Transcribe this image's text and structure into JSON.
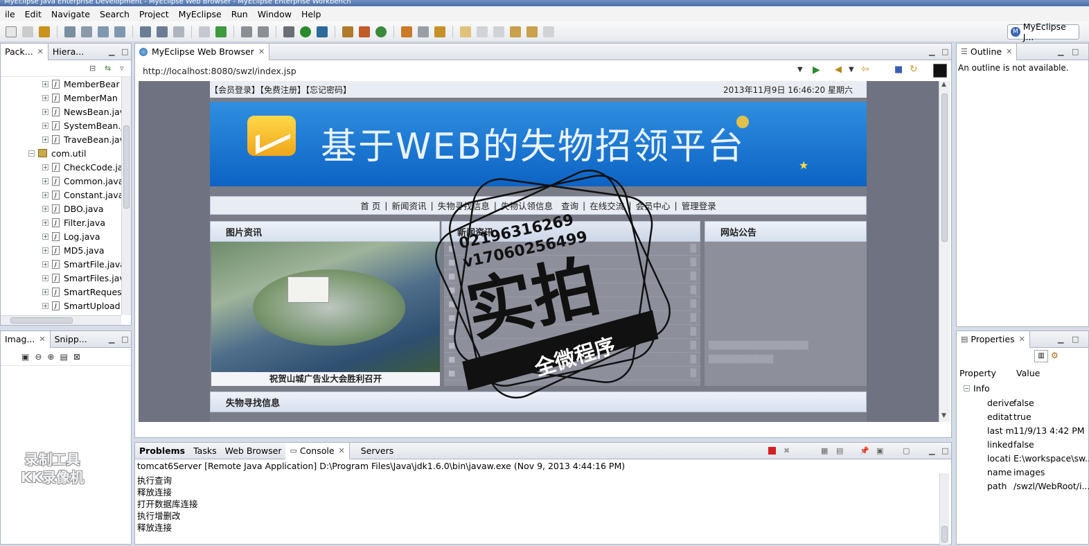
{
  "window": {
    "title": "MyEclipse Java Enterprise Development - MyEclipse Web Browser - MyEclipse Enterprise Workbench"
  },
  "menu": [
    "ile",
    "Edit",
    "Navigate",
    "Search",
    "Project",
    "MyEclipse",
    "Run",
    "Window",
    "Help"
  ],
  "perspective": {
    "label": "MyEclipse J..."
  },
  "package_explorer": {
    "tabs": [
      "Pack...",
      "Hiera..."
    ],
    "items": [
      {
        "label": "MemberBear",
        "type": "java"
      },
      {
        "label": "MemberMan",
        "type": "java"
      },
      {
        "label": "NewsBean.jav",
        "type": "java"
      },
      {
        "label": "SystemBean.j",
        "type": "java"
      },
      {
        "label": "TraveBean.jav",
        "type": "java"
      },
      {
        "label": "com.util",
        "type": "package"
      },
      {
        "label": "CheckCode.ja",
        "type": "java"
      },
      {
        "label": "Common.java",
        "type": "java"
      },
      {
        "label": "Constant.java",
        "type": "java"
      },
      {
        "label": "DBO.java",
        "type": "java"
      },
      {
        "label": "Filter.java",
        "type": "java"
      },
      {
        "label": "Log.java",
        "type": "java"
      },
      {
        "label": "MD5.java",
        "type": "java"
      },
      {
        "label": "SmartFile.java",
        "type": "java"
      },
      {
        "label": "SmartFiles.jav",
        "type": "java"
      },
      {
        "label": "SmartReques",
        "type": "java"
      },
      {
        "label": "SmartUpload",
        "type": "java"
      }
    ]
  },
  "image_panel": {
    "tabs": [
      "Imag...",
      "Snipp..."
    ]
  },
  "browser": {
    "tab": "MyEclipse Web Browser",
    "url": "http://localhost:8080/swzl/index.jsp",
    "site": {
      "top_links": "【会员登录】【免费注册】【忘记密码】",
      "datetime": "2013年11月9日  16:46:20   星期六",
      "banner_title": "基于WEB的失物招领平台",
      "nav": [
        "首 页",
        "新闻资讯",
        "失物寻找信息",
        "失物认领信息",
        "查询",
        "在线交流",
        "会员中心",
        "管理登录"
      ],
      "boxes": {
        "photo_title": "图片资讯",
        "news_title": "新闻资讯",
        "notice_title": "网站公告",
        "lost_title": "失物寻找信息"
      },
      "photo_caption": "祝贺山城广告业大会胜利召开"
    }
  },
  "outline": {
    "tab": "Outline",
    "message": "An outline is not available."
  },
  "properties": {
    "tab": "Properties",
    "headers": [
      "Property",
      "Value"
    ],
    "group": "Info",
    "rows": [
      {
        "k": "derive",
        "v": "false"
      },
      {
        "k": "editat",
        "v": "true"
      },
      {
        "k": "last m",
        "v": "11/9/13 4:42 PM"
      },
      {
        "k": "linked",
        "v": "false"
      },
      {
        "k": "locati",
        "v": "E:\\workspace\\sw..."
      },
      {
        "k": "name",
        "v": "images"
      },
      {
        "k": "path",
        "v": "/swzl/WebRoot/i..."
      }
    ]
  },
  "bottom": {
    "tabs": [
      "Problems",
      "Tasks",
      "Web Browser",
      "Console",
      "Servers"
    ],
    "server_line": "tomcat6Server [Remote Java Application] D:\\Program Files\\Java\\jdk1.6.0\\bin\\javaw.exe (Nov 9, 2013 4:44:16 PM)",
    "console_lines": [
      "执行查询",
      "释放连接",
      "打开数据库连接",
      "执行增删改",
      "释放连接"
    ]
  },
  "watermark": {
    "line1": "02196316269",
    "line2": "v17060256499",
    "big": "实拍",
    "ribbon": "全微程序",
    "recorder": [
      "录制工具",
      "KK录像机"
    ]
  },
  "colors": {
    "accent": "#1466c4",
    "tab_bg": "#dfe3ea",
    "page_bg": "#6f7280"
  }
}
